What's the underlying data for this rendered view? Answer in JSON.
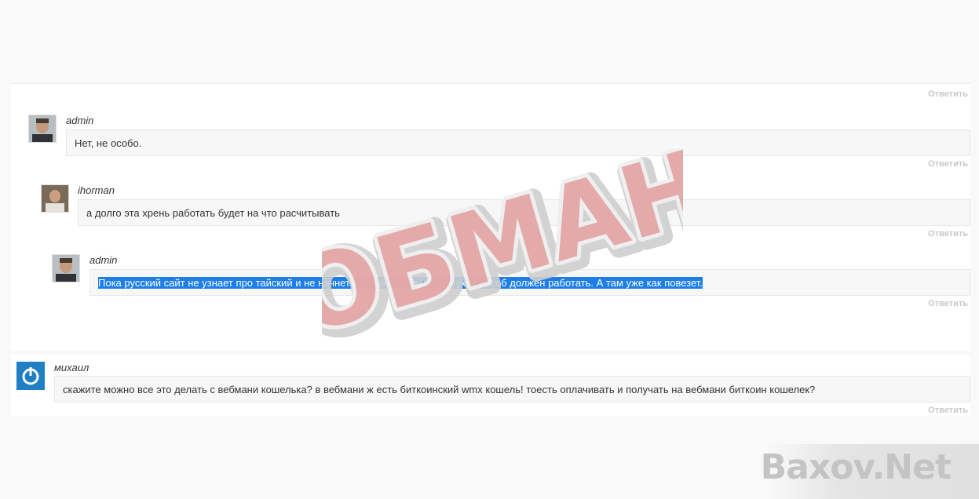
{
  "reply_label": "Ответить",
  "comments": [
    {
      "author": "admin",
      "text": "Нет, не особо."
    },
    {
      "author": "ihorman",
      "text": "а долго эта хрень работать будет на что расчитывать"
    },
    {
      "author": "admin",
      "text": "Пока русский сайт не узнает про тайский и не начнет продавать им напрямую, способ должен работать. А там уже как повезет."
    },
    {
      "author": "михаил",
      "text": "скажите можно все это делать с вебмани кошелька? в вебмани ж есть биткоинский wmx кошель! тоесть оплачивать и получать на вебмани биткоин кошелек?"
    }
  ],
  "stamp_text": "ОБМАН",
  "watermark_text": "Baxov.Net",
  "colors": {
    "selection": "#1e7ee8",
    "stamp": "#e8a2a2",
    "reply": "#c8c8c8"
  }
}
